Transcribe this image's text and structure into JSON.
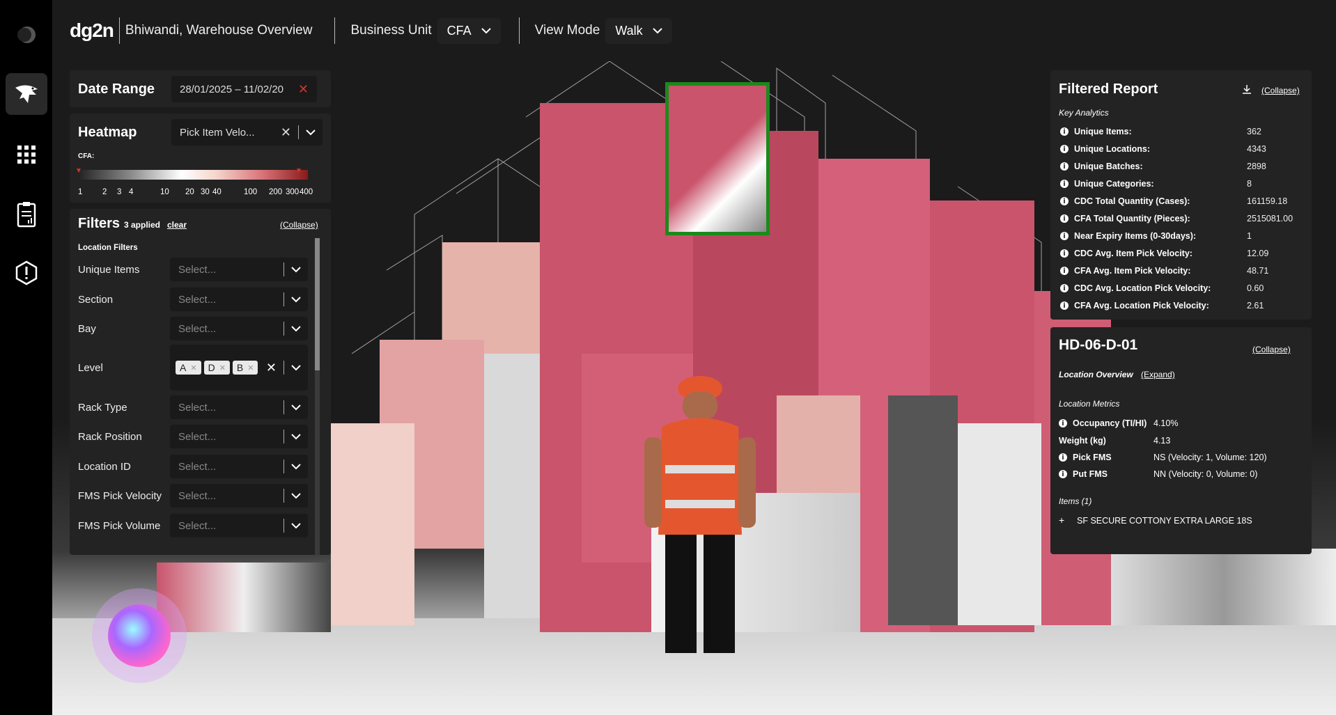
{
  "sidebar": {
    "icons": [
      "app-logo-icon",
      "eagle-icon",
      "grid-icon",
      "report-icon",
      "alert-icon"
    ]
  },
  "topbar": {
    "logo": "dg2n",
    "title": "Bhiwandi, Warehouse Overview",
    "business_unit_label": "Business Unit",
    "business_unit_value": "CFA",
    "view_mode_label": "View Mode",
    "view_mode_value": "Walk"
  },
  "date_range": {
    "label": "Date Range",
    "value": "28/01/2025 – 11/02/20"
  },
  "heatmap": {
    "label": "Heatmap",
    "value": "Pick Item Velo...",
    "legend_label": "CFA:",
    "ticks": [
      "1",
      "2",
      "3",
      "4",
      "10",
      "20",
      "30",
      "40",
      "100",
      "200",
      "300",
      "400"
    ]
  },
  "filters": {
    "title": "Filters",
    "applied": "3 applied",
    "clear": "clear",
    "collapse": "(Collapse)",
    "section": "Location Filters",
    "placeholder": "Select...",
    "items": [
      "Unique Items",
      "Section",
      "Bay",
      "Level",
      "Rack Type",
      "Rack Position",
      "Location ID",
      "FMS Pick Velocity",
      "FMS Pick Volume"
    ],
    "level_chips": [
      "A",
      "D",
      "B"
    ]
  },
  "report": {
    "title": "Filtered Report",
    "collapse": "(Collapse)",
    "subtitle": "Key Analytics",
    "rows": [
      {
        "label": "Unique Items:",
        "value": "362"
      },
      {
        "label": "Unique Locations:",
        "value": "4343"
      },
      {
        "label": "Unique Batches:",
        "value": "2898"
      },
      {
        "label": "Unique Categories:",
        "value": "8"
      },
      {
        "label": "CDC Total Quantity (Cases):",
        "value": "161159.18"
      },
      {
        "label": "CFA Total Quantity (Pieces):",
        "value": "2515081.00"
      },
      {
        "label": "Near Expiry Items (0-30days):",
        "value": "1"
      },
      {
        "label": "CDC Avg. Item Pick Velocity:",
        "value": "12.09"
      },
      {
        "label": "CFA Avg. Item Pick Velocity:",
        "value": "48.71"
      },
      {
        "label": "CDC Avg. Location Pick Velocity:",
        "value": "0.60"
      },
      {
        "label": "CFA Avg. Location Pick Velocity:",
        "value": "2.61"
      }
    ]
  },
  "location": {
    "title": "HD-06-D-01",
    "collapse": "(Collapse)",
    "overview_label": "Location Overview",
    "expand": "(Expand)",
    "metrics_label": "Location Metrics",
    "occupancy_label": "Occupancy (TI/HI)",
    "occupancy_value": "4.10%",
    "weight_label": "Weight (kg)",
    "weight_value": "4.13",
    "pick_fms_label": "Pick FMS",
    "pick_fms_value": "NS (Velocity: 1, Volume: 120)",
    "put_fms_label": "Put FMS",
    "put_fms_value": "NN (Velocity: 0, Volume: 0)",
    "items_label": "Items (1)",
    "item_name": "SF SECURE COTTONY EXTRA LARGE 18S"
  },
  "colors": {
    "accent_red": "#d9342b",
    "rack_pink": "#c9546b",
    "highlight_green": "#1b8a1b",
    "vest_orange": "#e4572e"
  }
}
